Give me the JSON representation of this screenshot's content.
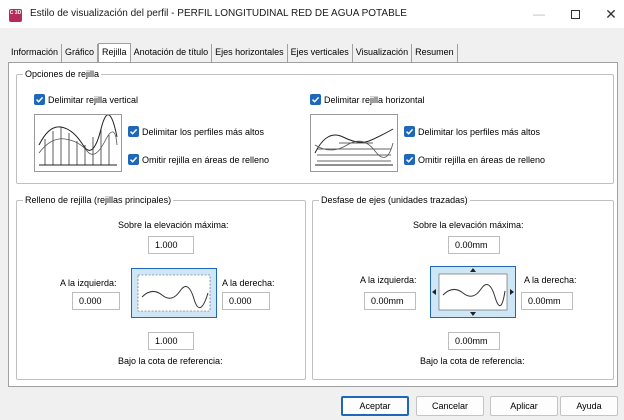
{
  "window": {
    "icon_text": "C 3D",
    "title": "Estilo de visualización del perfil - PERFIL LONGITUDINAL RED DE AGUA POTABLE",
    "controls": {
      "minimize": "—",
      "maximize": "",
      "close": "✕"
    }
  },
  "tabs": [
    {
      "label": "Información",
      "active": false
    },
    {
      "label": "Gráfico",
      "active": false
    },
    {
      "label": "Rejilla",
      "active": true
    },
    {
      "label": "Anotación de título",
      "active": false
    },
    {
      "label": "Ejes horizontales",
      "active": false
    },
    {
      "label": "Ejes verticales",
      "active": false
    },
    {
      "label": "Visualización",
      "active": false
    },
    {
      "label": "Resumen",
      "active": false
    }
  ],
  "grid_options": {
    "title": "Opciones de rejilla",
    "vertical": {
      "label": "Delimitar rejilla vertical",
      "checked": true,
      "higher_profiles": {
        "label": "Delimitar los perfiles más altos",
        "checked": true
      },
      "omit_fill": {
        "label": "Omitir rejilla en áreas de relleno",
        "checked": true
      }
    },
    "horizontal": {
      "label": "Delimitar rejilla horizontal",
      "checked": true,
      "higher_profiles": {
        "label": "Delimitar los perfiles más altos",
        "checked": true
      },
      "omit_fill": {
        "label": "Omitir rejilla en áreas de relleno",
        "checked": true
      }
    }
  },
  "grid_fill": {
    "title": "Relleno de rejilla (rejillas principales)",
    "above_label": "Sobre la elevación máxima:",
    "above_value": "1.000",
    "left_label": "A la izquierda:",
    "left_value": "0.000",
    "right_label": "A la derecha:",
    "right_value": "0.000",
    "below_value": "1.000",
    "below_label": "Bajo la cota de referencia:"
  },
  "axis_offset": {
    "title": "Desfase de ejes (unidades trazadas)",
    "above_label": "Sobre la elevación máxima:",
    "above_value": "0.00mm",
    "left_label": "A la izquierda:",
    "left_value": "0.00mm",
    "right_label": "A la derecha:",
    "right_value": "0.00mm",
    "below_value": "0.00mm",
    "below_label": "Bajo la cota de referencia:"
  },
  "buttons": {
    "accept": "Aceptar",
    "cancel": "Cancelar",
    "apply": "Aplicar",
    "help": "Ayuda"
  },
  "colors": {
    "accent": "#1f67b8",
    "app_icon": "#b42a5d",
    "preview_fill": "#cfe6f6",
    "preview_border": "#1f67b8"
  },
  "icons": {
    "checkbox": "checkmark-icon",
    "vertical_preview": "vertical-grid-profile-icon",
    "horizontal_preview": "horizontal-grid-profile-icon",
    "fill_preview": "grid-fill-preview-icon",
    "offset_preview": "axis-offset-preview-icon"
  }
}
